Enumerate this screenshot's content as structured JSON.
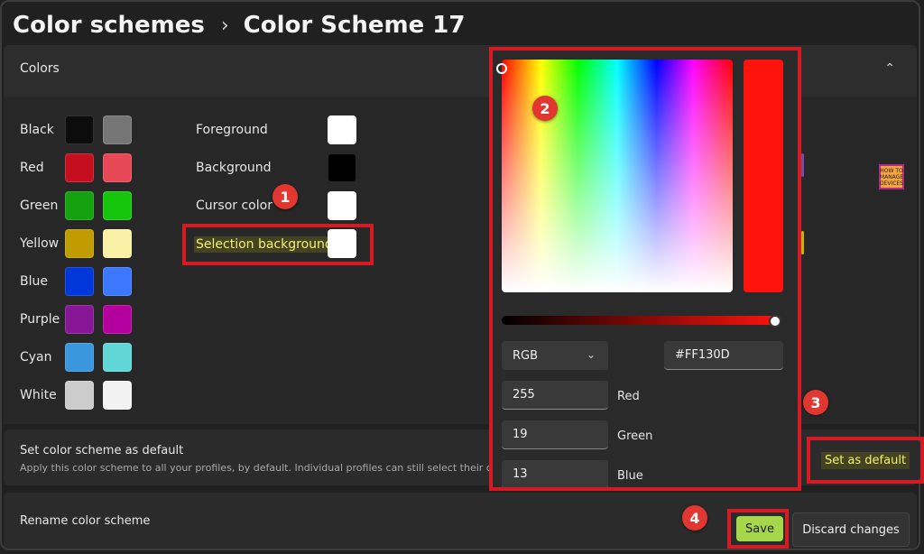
{
  "breadcrumb": {
    "parent": "Color schemes",
    "separator": "›",
    "current": "Color Scheme 17"
  },
  "colors_section": {
    "title": "Colors",
    "collapse_icon": "chevron-up-icon",
    "palette": [
      {
        "name": "Black",
        "dark": "#0c0c0c",
        "bright": "#767676"
      },
      {
        "name": "Red",
        "dark": "#c50f1f",
        "bright": "#e74856"
      },
      {
        "name": "Green",
        "dark": "#13a10e",
        "bright": "#16c60c"
      },
      {
        "name": "Yellow",
        "dark": "#c19c00",
        "bright": "#f9f1a5"
      },
      {
        "name": "Blue",
        "dark": "#0037da",
        "bright": "#3b78ff"
      },
      {
        "name": "Purple",
        "dark": "#881798",
        "bright": "#b4009e"
      },
      {
        "name": "Cyan",
        "dark": "#3a96dd",
        "bright": "#61d6d6"
      },
      {
        "name": "White",
        "dark": "#cccccc",
        "bright": "#f2f2f2"
      }
    ],
    "special": [
      {
        "name": "Foreground",
        "color": "#ffffff"
      },
      {
        "name": "Background",
        "color": "#000000"
      },
      {
        "name": "Cursor color",
        "color": "#ffffff"
      },
      {
        "name": "Selection background",
        "color": "#ffffff"
      }
    ]
  },
  "color_picker": {
    "selected_color": "#FF130D",
    "mode": "RGB",
    "mode_icon": "chevron-down-icon",
    "hex": "#FF130D",
    "channels": [
      {
        "value": "255",
        "label": "Red"
      },
      {
        "value": "19",
        "label": "Green"
      },
      {
        "value": "13",
        "label": "Blue"
      }
    ]
  },
  "default_section": {
    "title": "Set color scheme as default",
    "description": "Apply this color scheme to all your profiles, by default. Individual profiles can still select their c",
    "button": "Set as default"
  },
  "rename_section": {
    "title": "Rename color scheme"
  },
  "actions": {
    "save": "Save",
    "discard": "Discard changes"
  },
  "annotations": [
    "1",
    "2",
    "3",
    "4"
  ],
  "logo_text": "HOW TO MANAGE DEVICES"
}
